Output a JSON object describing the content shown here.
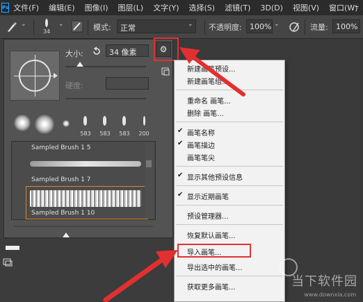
{
  "menubar": {
    "logo": "Ps",
    "items": [
      "文件(F)",
      "编辑(E)",
      "图像(I)",
      "图层(L)",
      "文字(Y)",
      "选择(S)",
      "滤镜(T)",
      "3D(D)",
      "视图(V)",
      "窗口(W)"
    ],
    "minimize": "–"
  },
  "optbar": {
    "brush_size": "34",
    "mode_label": "模式:",
    "mode_value": "正常",
    "opacity_label": "不透明度:",
    "opacity_value": "100%",
    "flow_label": "流量:",
    "flow_value": "100%"
  },
  "panel": {
    "size_label": "大小:",
    "size_value": "34 像素",
    "hardness_label": "硬度:",
    "preset_numbers": [
      "583",
      "583",
      "583",
      "200"
    ],
    "list": {
      "items": [
        "Sampled Brush 1 5",
        "Sampled Brush 1 7",
        "Sampled Brush 1 10"
      ]
    }
  },
  "menu": {
    "items": [
      "新建画笔预设...",
      "新建画笔组...",
      "重命名 画笔...",
      "删除 画笔...",
      "画笔名称",
      "画笔描边",
      "画笔笔尖",
      "显示其他预设信息",
      "显示近期画笔",
      "预设管理器...",
      "恢复默认画笔...",
      "导入画笔...",
      "导出选中的画笔...",
      "获取更多画笔..."
    ],
    "check": "✔"
  },
  "watermark": {
    "text": "当下软件园",
    "url": "www.downxia.com"
  },
  "colors": {
    "highlight_red": "#e23030",
    "selection_orange": "#d88a2c"
  },
  "icons": [
    "brush-icon",
    "gear-icon",
    "reset-icon",
    "new-preset-icon",
    "airbrush-icon"
  ]
}
